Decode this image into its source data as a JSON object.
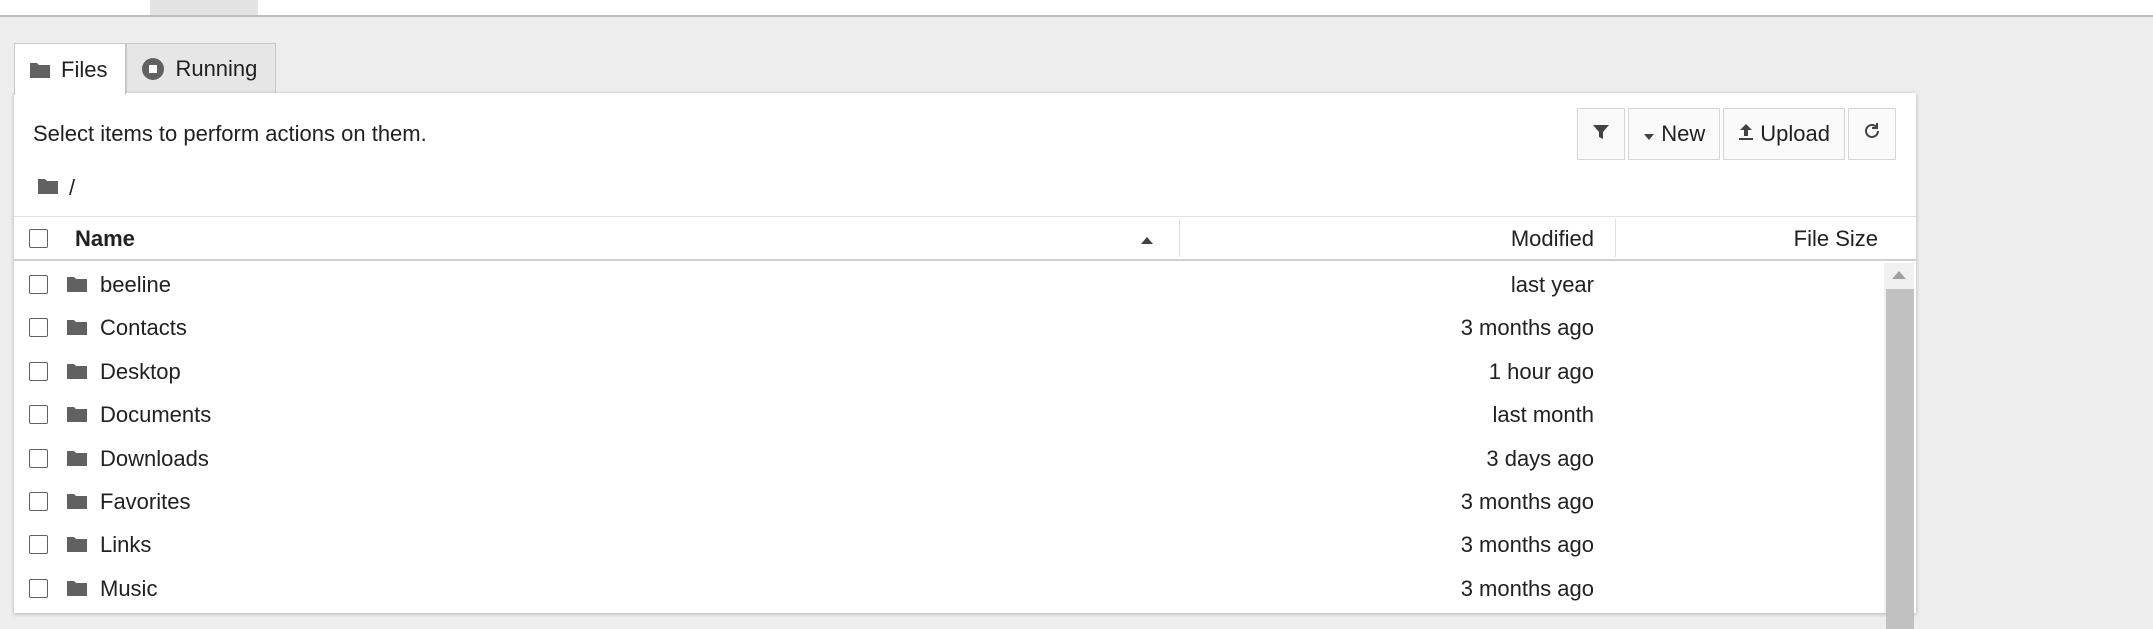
{
  "tabs": [
    {
      "label": "Files",
      "icon": "folder-icon",
      "active": true
    },
    {
      "label": "Running",
      "icon": "stop-circle-icon",
      "active": false
    }
  ],
  "toolbar": {
    "info_text": "Select items to perform actions on them.",
    "new_label": "New",
    "upload_label": "Upload"
  },
  "breadcrumb": {
    "path": "/"
  },
  "table": {
    "columns": {
      "name": "Name",
      "modified": "Modified",
      "file_size": "File Size"
    },
    "rows": [
      {
        "name": "beeline",
        "modified": "last year"
      },
      {
        "name": "Contacts",
        "modified": "3 months ago"
      },
      {
        "name": "Desktop",
        "modified": "1 hour ago"
      },
      {
        "name": "Documents",
        "modified": "last month"
      },
      {
        "name": "Downloads",
        "modified": "3 days ago"
      },
      {
        "name": "Favorites",
        "modified": "3 months ago"
      },
      {
        "name": "Links",
        "modified": "3 months ago"
      },
      {
        "name": "Music",
        "modified": "3 months ago"
      }
    ]
  },
  "colors": {
    "background": "#eeeeee",
    "icon": "#616161"
  }
}
